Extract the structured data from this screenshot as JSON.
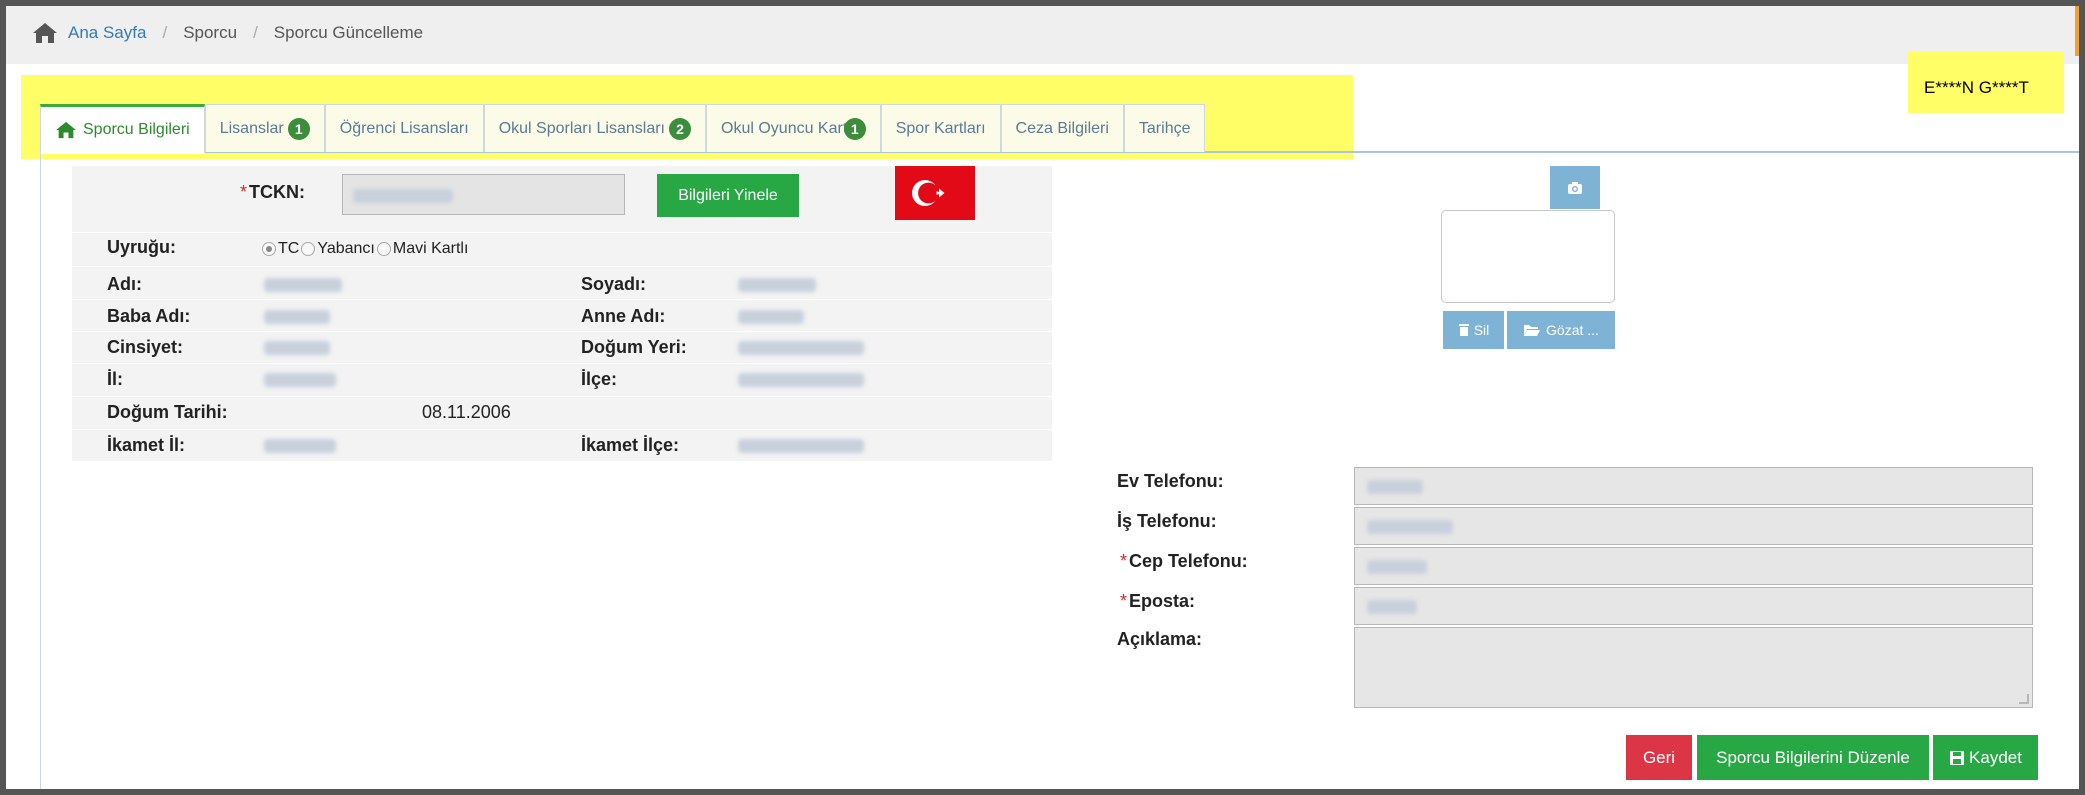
{
  "breadcrumb": {
    "home": "Ana Sayfa",
    "item1": "Sporcu",
    "item2": "Sporcu Güncelleme",
    "separator": "/"
  },
  "user": {
    "name": "E****N G****T"
  },
  "tabs": [
    {
      "label": "Sporcu Bilgileri",
      "active": true,
      "icon": "home-icon"
    },
    {
      "label": "Lisanslar",
      "badge": "1"
    },
    {
      "label": "Öğrenci Lisansları"
    },
    {
      "label": "Okul Sporları Lisansları",
      "badge": "2"
    },
    {
      "label": "Okul Oyuncu Kartı",
      "badge": "1"
    },
    {
      "label": "Spor Kartları"
    },
    {
      "label": "Ceza Bilgileri"
    },
    {
      "label": "Tarihçe"
    }
  ],
  "form": {
    "tckn_label": "TCKN:",
    "required_mark": "*",
    "refresh_button": "Bilgileri Yinele",
    "nationality_label": "Uyruğu:",
    "nationality_options": [
      "TC",
      "Yabancı",
      "Mavi Kartlı"
    ],
    "nationality_selected": "TC",
    "name_label": "Adı:",
    "surname_label": "Soyadı:",
    "father_label": "Baba Adı:",
    "mother_label": "Anne Adı:",
    "gender_label": "Cinsiyet:",
    "birthplace_label": "Doğum Yeri:",
    "province_label": "İl:",
    "district_label": "İlçe:",
    "birthdate_label": "Doğum Tarihi:",
    "birthdate_value": "08.11.2006",
    "res_province_label": "İkamet İl:",
    "res_district_label": "İkamet İlçe:"
  },
  "photo": {
    "delete_button": "Sil",
    "browse_button": "Gözat ..."
  },
  "contact": {
    "home_phone_label": "Ev Telefonu:",
    "work_phone_label": "İş Telefonu:",
    "mobile_label": "Cep Telefonu:",
    "email_label": "Eposta:",
    "note_label": "Açıklama:"
  },
  "actions": {
    "back": "Geri",
    "edit": "Sporcu Bilgilerini Düzenle",
    "save": "Kaydet"
  },
  "colors": {
    "highlight": "#fffe66",
    "green": "#28a745",
    "red": "#dc3545",
    "link": "#337ab7",
    "flag_red": "#e30a17"
  }
}
